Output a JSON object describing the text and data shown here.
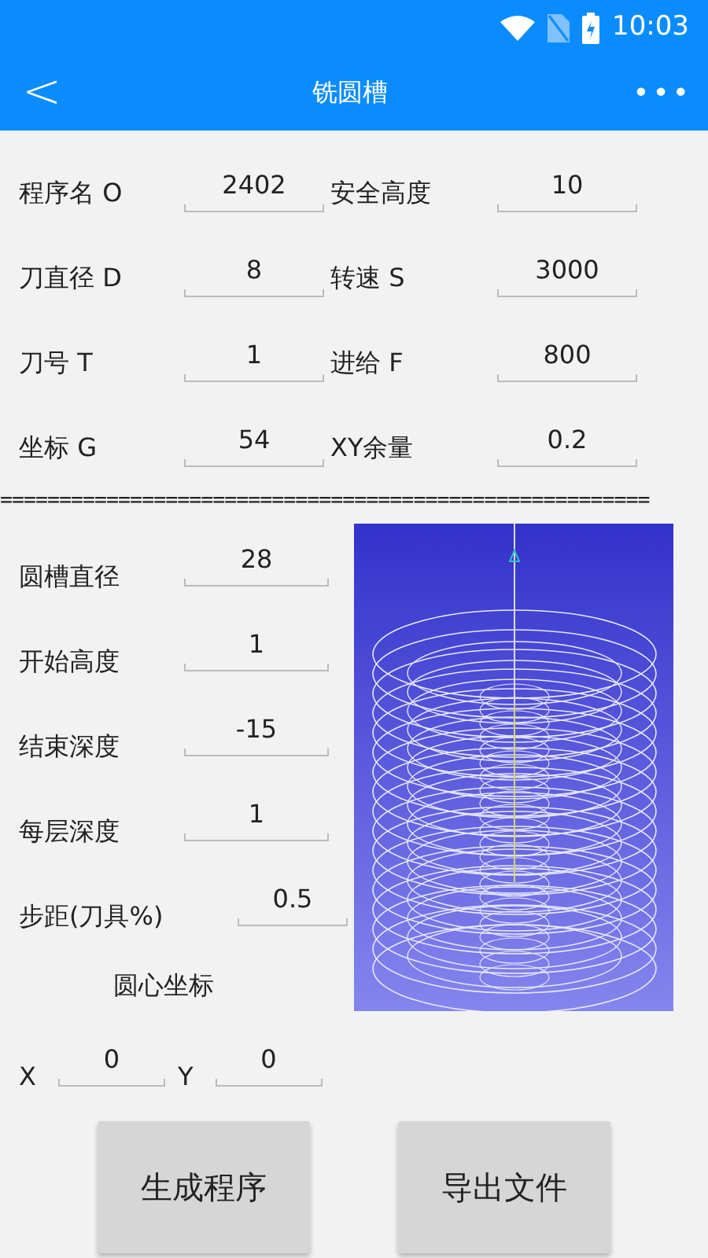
{
  "status_bar": {
    "time": "10:03"
  },
  "toolbar": {
    "back": "<",
    "title": "铣圆槽",
    "menu": "•••"
  },
  "params": [
    {
      "label": "程序名 O",
      "value": "2402"
    },
    {
      "label": "安全高度",
      "value": "10"
    },
    {
      "label": "刀直径 D",
      "value": "8"
    },
    {
      "label": "转速 S",
      "value": "3000"
    },
    {
      "label": "刀号 T",
      "value": "1"
    },
    {
      "label": "进给 F",
      "value": "800"
    },
    {
      "label": "坐标 G",
      "value": "54"
    },
    {
      "label": "XY余量",
      "value": "0.2"
    }
  ],
  "separator": "=======================================================",
  "groove_params": [
    {
      "label": "圆槽直径",
      "value": "28"
    },
    {
      "label": "开始高度",
      "value": "1"
    },
    {
      "label": "结束深度",
      "value": "-15"
    },
    {
      "label": "每层深度",
      "value": "1"
    },
    {
      "label": "步距(刀具%)",
      "value": "0.5",
      "kind": "wide"
    }
  ],
  "center_label": "圆心坐标",
  "center": [
    {
      "label": "X",
      "value": "0"
    },
    {
      "label": "Y",
      "value": "0"
    }
  ],
  "buttons": [
    "生成程序",
    "导出文件"
  ]
}
